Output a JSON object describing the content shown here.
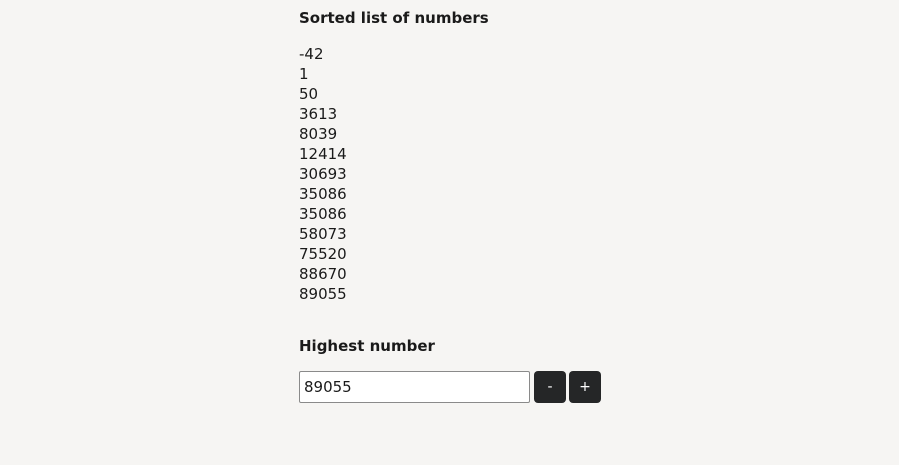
{
  "sorted_section": {
    "title": "Sorted list of numbers",
    "numbers": [
      "-42",
      "1",
      "50",
      "3613",
      "8039",
      "12414",
      "30693",
      "35086",
      "35086",
      "58073",
      "75520",
      "88670",
      "89055"
    ]
  },
  "highest_section": {
    "title": "Highest number",
    "input_value": "89055",
    "decrement_label": "-",
    "increment_label": "+"
  }
}
